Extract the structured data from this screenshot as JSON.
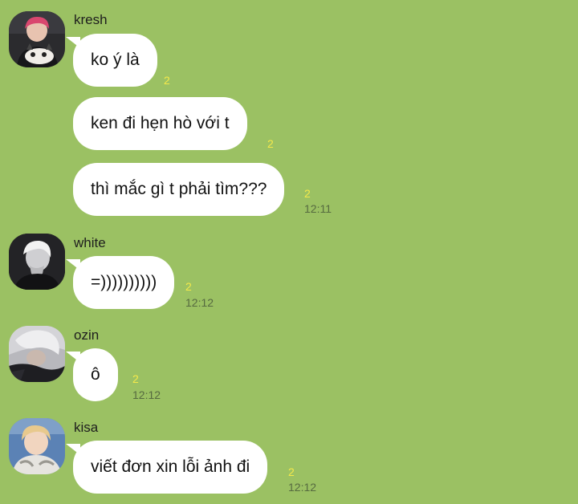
{
  "colors": {
    "background": "#9bc163",
    "bubble": "#ffffff",
    "read_count": "#f5e94a",
    "timestamp": "#566a40"
  },
  "groups": [
    {
      "sender": "kresh",
      "avatar_icon": "user-avatar-kresh",
      "messages": [
        {
          "text": "ko ý là",
          "read": "2"
        },
        {
          "text": "ken đi hẹn hò với t",
          "read": "2"
        },
        {
          "text": "thì mắc gì t phải tìm???",
          "read": "2",
          "time": "12:11"
        }
      ]
    },
    {
      "sender": "white",
      "avatar_icon": "user-avatar-white",
      "messages": [
        {
          "text": "=))))))))))",
          "read": "2",
          "time": "12:12"
        }
      ]
    },
    {
      "sender": "ozin",
      "avatar_icon": "user-avatar-ozin",
      "messages": [
        {
          "text": "ô",
          "read": "2",
          "time": "12:12"
        }
      ]
    },
    {
      "sender": "kisa",
      "avatar_icon": "user-avatar-kisa",
      "messages": [
        {
          "text": "viết đơn xin lỗi ảnh đi",
          "read": "2",
          "time": "12:12"
        }
      ]
    }
  ]
}
